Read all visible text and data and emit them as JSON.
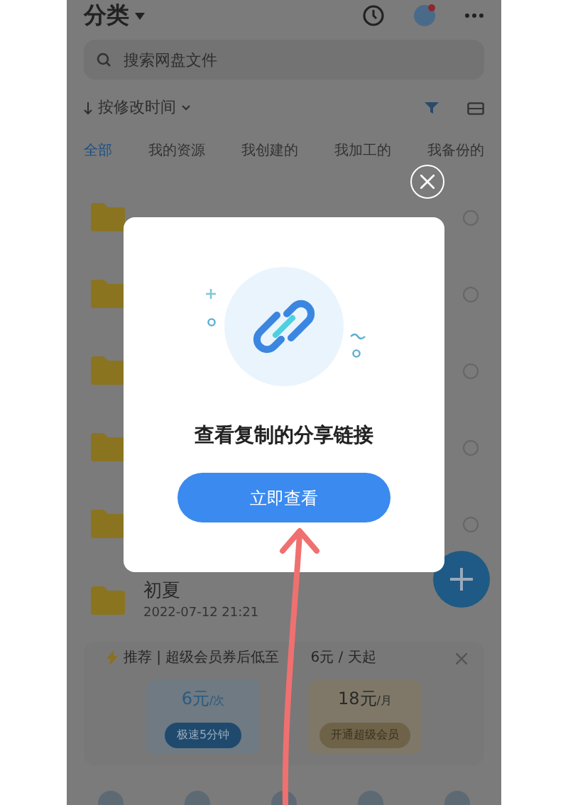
{
  "header": {
    "title": "分类"
  },
  "search": {
    "placeholder": "搜索网盘文件"
  },
  "sort": {
    "label": "按修改时间"
  },
  "tabs": [
    {
      "label": "全部",
      "selected": true
    },
    {
      "label": "我的资源",
      "selected": false
    },
    {
      "label": "我创建的",
      "selected": false
    },
    {
      "label": "我加工的",
      "selected": false
    },
    {
      "label": "我备份的",
      "selected": false
    }
  ],
  "files": [
    {
      "kind": "folder",
      "selected": false
    },
    {
      "kind": "folder",
      "selected": false
    },
    {
      "kind": "folder",
      "selected": false
    },
    {
      "kind": "folder",
      "selected": false
    },
    {
      "kind": "folder",
      "selected": false
    },
    {
      "kind": "folder",
      "name": "初夏",
      "date": "2022-07-12 21:21"
    }
  ],
  "promo": {
    "title": "推荐 | 超级会员券后低至",
    "price": "6元 / 天起",
    "cards": [
      {
        "price": "6元",
        "unit": "/次",
        "button": "极速5分钟",
        "kind": "blue"
      },
      {
        "price": "18元",
        "unit": "/月",
        "button": "开通超级会员",
        "kind": "gold"
      }
    ]
  },
  "dialog": {
    "message": "查看复制的分享链接",
    "button": "立即查看"
  }
}
